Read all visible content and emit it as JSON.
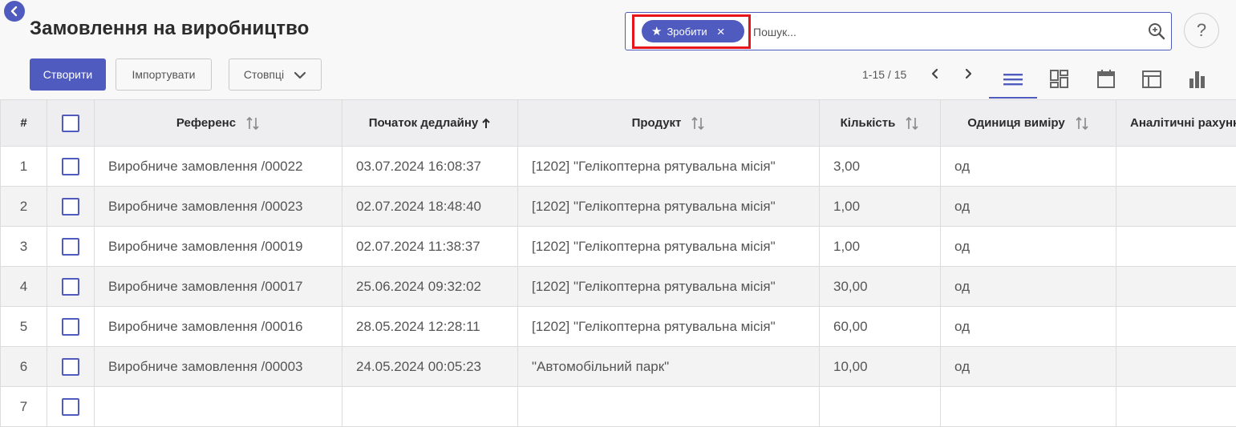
{
  "page": {
    "title": "Замовлення на виробництво"
  },
  "search": {
    "facet_label": "Зробити",
    "placeholder": "Пошук..."
  },
  "help": {
    "label": "?"
  },
  "toolbar": {
    "create_label": "Створити",
    "import_label": "Імпортувати",
    "columns_label": "Стовпці"
  },
  "pager": {
    "range": "1-15 / 15"
  },
  "views": [
    "list",
    "kanban",
    "calendar",
    "pivot",
    "graph"
  ],
  "colors": {
    "accent": "#4f5bbf",
    "highlight": "#e8141a"
  },
  "table": {
    "headers": {
      "num": "#",
      "reference": "Референс",
      "deadline": "Початок дедлайну",
      "product": "Продукт",
      "quantity": "Кількість",
      "uom": "Одиниця виміру",
      "analytic": "Аналітичні рахунки"
    },
    "rows": [
      {
        "num": "1",
        "reference": "Виробниче замовлення /00022",
        "deadline": "03.07.2024 16:08:37",
        "product": "[1202] \"Гелікоптерна рятувальна місія\"",
        "quantity": "3,00",
        "uom": "од",
        "analytic": ""
      },
      {
        "num": "2",
        "reference": "Виробниче замовлення /00023",
        "deadline": "02.07.2024 18:48:40",
        "product": "[1202] \"Гелікоптерна рятувальна місія\"",
        "quantity": "1,00",
        "uom": "од",
        "analytic": ""
      },
      {
        "num": "3",
        "reference": "Виробниче замовлення /00019",
        "deadline": "02.07.2024 11:38:37",
        "product": "[1202] \"Гелікоптерна рятувальна місія\"",
        "quantity": "1,00",
        "uom": "од",
        "analytic": ""
      },
      {
        "num": "4",
        "reference": "Виробниче замовлення /00017",
        "deadline": "25.06.2024 09:32:02",
        "product": "[1202] \"Гелікоптерна рятувальна місія\"",
        "quantity": "30,00",
        "uom": "од",
        "analytic": ""
      },
      {
        "num": "5",
        "reference": "Виробниче замовлення /00016",
        "deadline": "28.05.2024 12:28:11",
        "product": "[1202] \"Гелікоптерна рятувальна місія\"",
        "quantity": "60,00",
        "uom": "од",
        "analytic": ""
      },
      {
        "num": "6",
        "reference": "Виробниче замовлення /00003",
        "deadline": "24.05.2024 00:05:23",
        "product": "\"Автомобільний парк\"",
        "quantity": "10,00",
        "uom": "од",
        "analytic": ""
      },
      {
        "num": "7",
        "reference": "",
        "deadline": "",
        "product": "",
        "quantity": "",
        "uom": "",
        "analytic": ""
      }
    ]
  }
}
